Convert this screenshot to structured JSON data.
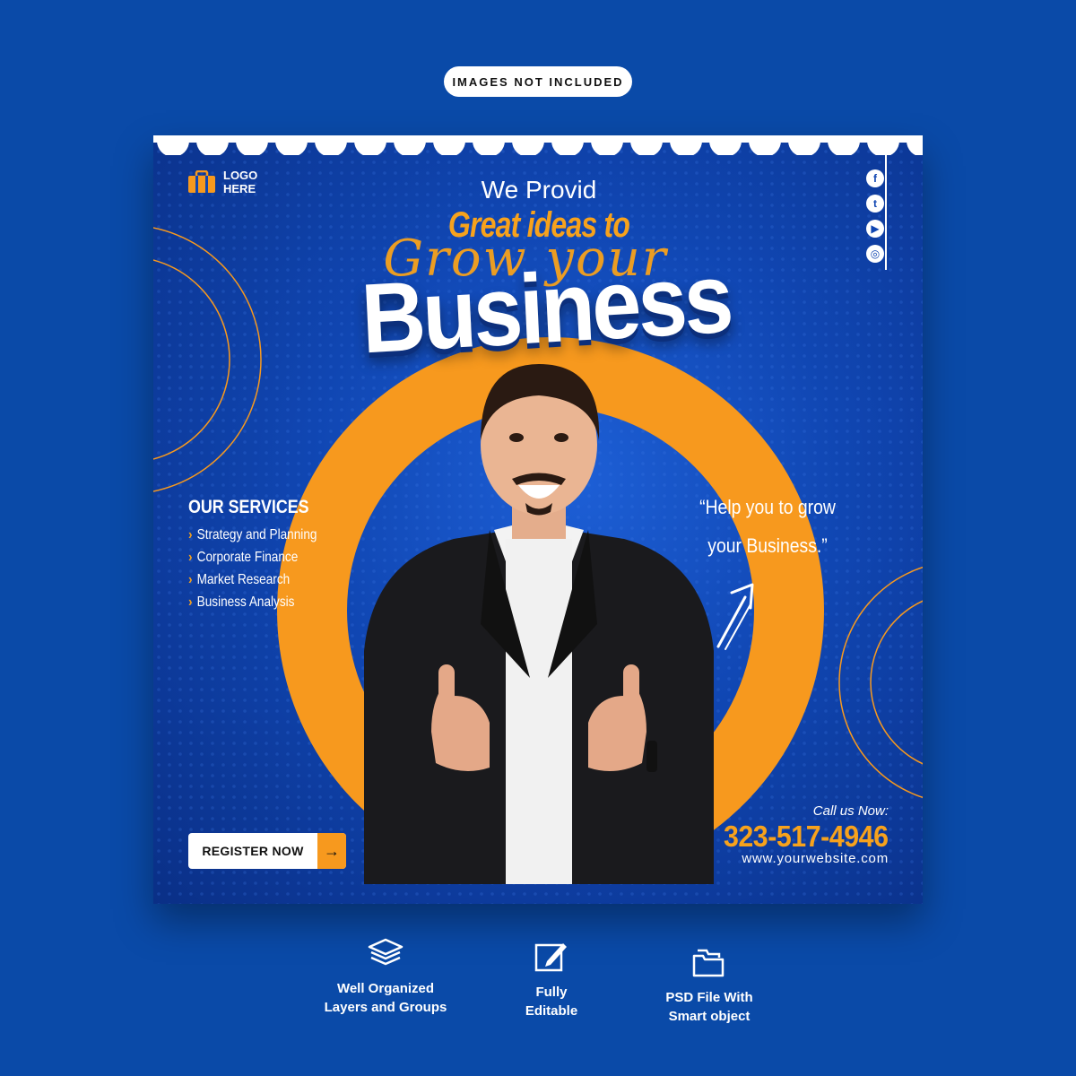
{
  "badge": {
    "label": "IMAGES NOT INCLUDED"
  },
  "logo": {
    "line1": "LOGO",
    "line2": "HERE",
    "icon": "briefcase-icon"
  },
  "social": [
    {
      "name": "facebook-icon",
      "glyph": "f"
    },
    {
      "name": "twitter-icon",
      "glyph": "t"
    },
    {
      "name": "youtube-icon",
      "glyph": "▶"
    },
    {
      "name": "instagram-icon",
      "glyph": "◎"
    }
  ],
  "headline": {
    "line1": "We Provid",
    "line2": "Great ideas to",
    "script": "Grow your",
    "main": "Business"
  },
  "services": {
    "title": "OUR SERVICES",
    "items": [
      "Strategy and Planning",
      "Corporate Finance",
      "Market Research",
      "Business Analysis"
    ]
  },
  "quote": {
    "line1": "“Help you to grow",
    "line2": "your Business.”"
  },
  "cta": {
    "label": "REGISTER NOW",
    "icon": "arrow-right-icon"
  },
  "contact": {
    "call_label": "Call us Now:",
    "phone": "323-517-4946",
    "website": "www.yourwebsite.com"
  },
  "features": [
    {
      "icon": "layers-icon",
      "line1": "Well Organized",
      "line2": "Layers and Groups"
    },
    {
      "icon": "edit-icon",
      "line1": "Fully",
      "line2": "Editable"
    },
    {
      "icon": "folder-icon",
      "line1": "PSD File With",
      "line2": "Smart object"
    }
  ],
  "colors": {
    "background": "#0a4aa8",
    "accent": "#f7991e",
    "card": "#1046b2"
  }
}
